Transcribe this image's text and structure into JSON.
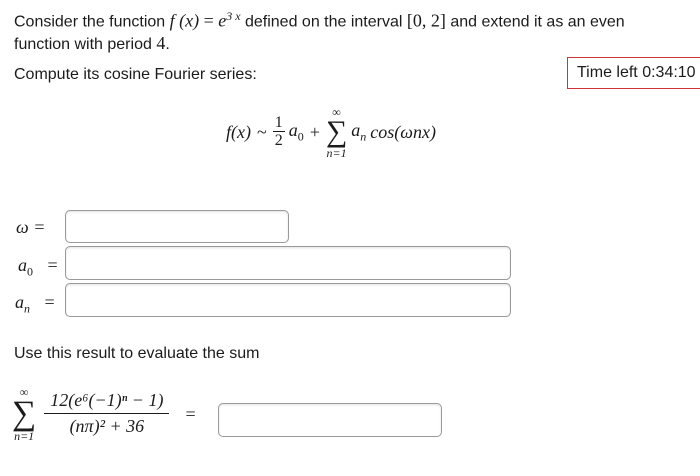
{
  "problem": {
    "intro_text": "Consider the function",
    "f_of_x": "f (x)",
    "equals": "=",
    "base": "e",
    "exponent": "3 x",
    "defined_text": "defined on the interval",
    "interval": "[0, 2]",
    "extend_text": "and extend it as an even",
    "line2_text": "function with period",
    "period": "4",
    "period_dot": ".",
    "compute_text": "Compute its cosine Fourier series:"
  },
  "timer": {
    "label": "Time left 0:34:10"
  },
  "series_formula": {
    "lhs": "f(x)",
    "tilde": "~",
    "half_num": "1",
    "half_den": "2",
    "a0": "a",
    "a0_sub": "0",
    "plus": "+",
    "sum_top": "∞",
    "sum_symbol": "∑",
    "sum_bottom": "n=1",
    "an": "a",
    "an_sub": "n",
    "cos_text": "cos(ωnx)"
  },
  "answers": {
    "omega_label": "ω =",
    "a0_label_main": "a",
    "a0_label_sub": "0",
    "a0_eq": "=",
    "an_label_main": "a",
    "an_label_sub": "n",
    "an_eq": "=",
    "omega_value": "",
    "a0_value": "",
    "an_value": ""
  },
  "evaluate": {
    "text": "Use this result to evaluate the sum",
    "sum_top": "∞",
    "sum_symbol": "∑",
    "sum_bottom": "n=1",
    "numerator": "12(e⁶(−1)ⁿ − 1)",
    "denominator": "(nπ)² + 36",
    "eq": "=",
    "sum_value": ""
  }
}
